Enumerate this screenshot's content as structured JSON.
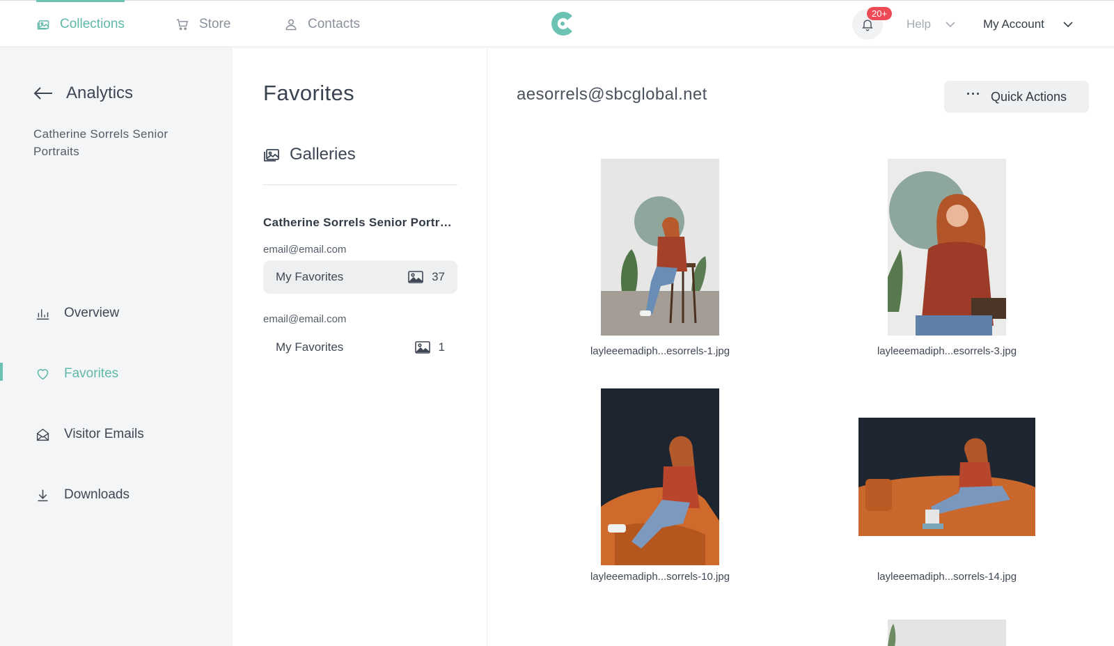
{
  "nav": {
    "items": [
      {
        "label": "Collections",
        "icon": "gallery-icon",
        "active": true
      },
      {
        "label": "Store",
        "icon": "cart-icon",
        "active": false
      },
      {
        "label": "Contacts",
        "icon": "person-icon",
        "active": false
      }
    ],
    "notification_badge": "20+",
    "help_label": "Help",
    "account_label": "My Account"
  },
  "sidebar": {
    "back_label": "Analytics",
    "collection_name": "Catherine Sorrels Senior Portraits",
    "items": [
      {
        "label": "Overview",
        "icon": "bar-chart-icon",
        "active": false
      },
      {
        "label": "Favorites",
        "icon": "heart-icon",
        "active": true
      },
      {
        "label": "Visitor Emails",
        "icon": "envelope-icon",
        "active": false
      },
      {
        "label": "Downloads",
        "icon": "download-icon",
        "active": false
      }
    ]
  },
  "middle": {
    "title": "Favorites",
    "galleries_label": "Galleries",
    "gallery_name": "Catherine Sorrels Senior Portraits",
    "lists": [
      {
        "email": "email@email.com",
        "label": "My Favorites",
        "count": "37",
        "selected": true
      },
      {
        "email": "email@email.com",
        "label": "My Favorites",
        "count": "1",
        "selected": false
      }
    ]
  },
  "content": {
    "visitor_email": "aesorrels@sbcglobal.net",
    "quick_actions_label": "Quick Actions",
    "photos": [
      {
        "filename": "layleeemadiph...esorrels-1.jpg"
      },
      {
        "filename": "layleeemadiph...esorrels-3.jpg"
      },
      {
        "filename": "layleeemadiph...sorrels-10.jpg"
      },
      {
        "filename": "layleeemadiph...sorrels-14.jpg"
      }
    ]
  },
  "colors": {
    "accent": "#6cc3b4",
    "badge": "#ee4a55",
    "sidebar_bg": "#f4f5f6"
  }
}
